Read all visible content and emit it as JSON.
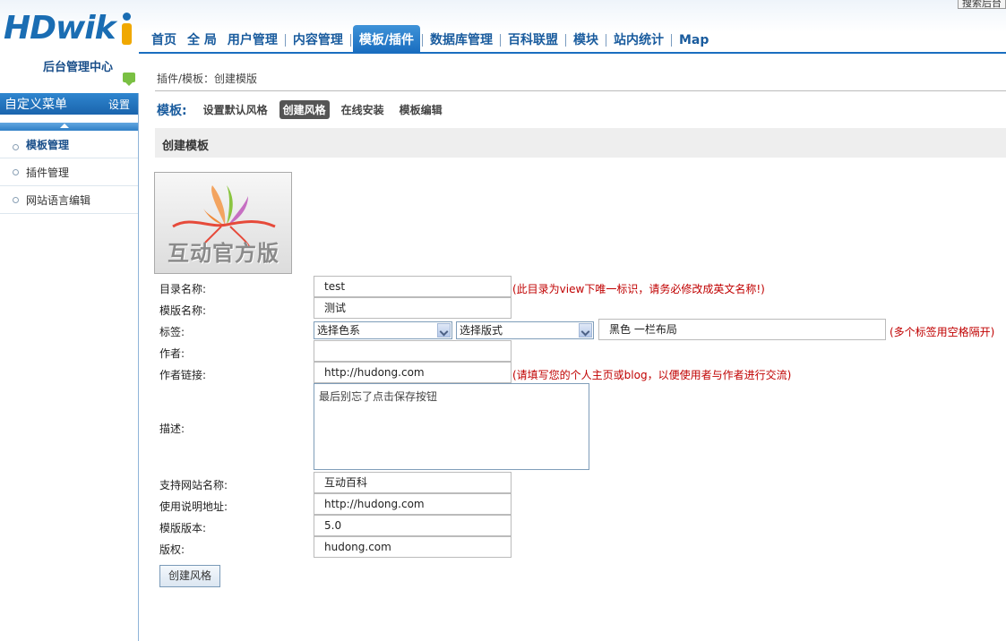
{
  "brand": {
    "logo": "HDwik",
    "subtitle": "后台管理中心"
  },
  "search_button": "搜索后台",
  "nav": [
    {
      "label": "首页"
    },
    {
      "label": "全 局"
    },
    {
      "label": "用户管理"
    },
    {
      "label": "内容管理"
    },
    {
      "label": "模板/插件",
      "active": true
    },
    {
      "label": "数据库管理"
    },
    {
      "label": "百科联盟"
    },
    {
      "label": "模块"
    },
    {
      "label": "站内统计"
    },
    {
      "label": "Map"
    }
  ],
  "sidebar": {
    "header": "自定义菜单",
    "settings": "设置",
    "items": [
      {
        "label": "模板管理",
        "active": true
      },
      {
        "label": "插件管理"
      },
      {
        "label": "网站语言编辑"
      }
    ]
  },
  "breadcrumb": "插件/模板：创建模版",
  "tabs": {
    "label": "模板:",
    "items": [
      "设置默认风格",
      "创建风格",
      "在线安装",
      "模板编辑"
    ],
    "active": "创建风格"
  },
  "section_title": "创建模板",
  "preview_text": "互动官方版",
  "form": {
    "dir_label": "目录名称:",
    "dir_value": "test",
    "dir_hint": "(此目录为view下唯一标识，请务必修改成英文名称!)",
    "name_label": "模版名称:",
    "name_value": "测试",
    "tags_label": "标签:",
    "color_select": "选择色系",
    "layout_select": "选择版式",
    "tags_value": "黑色 一栏布局",
    "tags_hint": "(多个标签用空格隔开)",
    "author_label": "作者:",
    "author_value": "",
    "author_link_label": "作者链接:",
    "author_link_value": "http://hudong.com",
    "author_link_hint": "(请填写您的个人主页或blog，以便使用者与作者进行交流)",
    "desc_label": "描述:",
    "desc_value": "最后别忘了点击保存按钮",
    "site_label": "支持网站名称:",
    "site_value": "互动百科",
    "doc_label": "使用说明地址:",
    "doc_value": "http://hudong.com",
    "version_label": "模版版本:",
    "version_value": "5.0",
    "copyright_label": "版权:",
    "copyright_value": "hudong.com",
    "submit": "创建风格"
  }
}
